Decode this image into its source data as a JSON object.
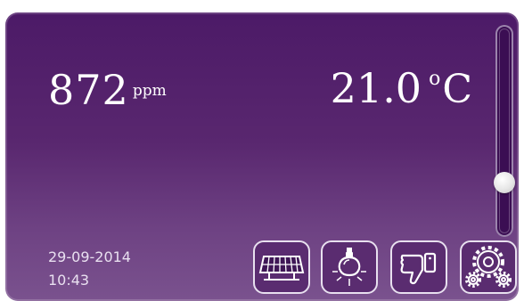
{
  "co2": {
    "value": "872",
    "unit": "ppm"
  },
  "temperature": {
    "value": "21.0",
    "unit_symbol": "C",
    "degree_symbol": "o"
  },
  "datetime": {
    "date": "29-09-2014",
    "time": "10:43"
  },
  "slider": {
    "level_fraction": 0.22
  },
  "colors": {
    "background": "#5a2872",
    "text": "#ffffff",
    "accent_border": "#e8e0ef"
  },
  "buttons": [
    {
      "name": "solar-panel",
      "icon": "solar-panel-icon"
    },
    {
      "name": "light",
      "icon": "lightbulb-icon"
    },
    {
      "name": "dislike",
      "icon": "thumbs-down-icon"
    },
    {
      "name": "settings",
      "icon": "gears-icon"
    }
  ]
}
